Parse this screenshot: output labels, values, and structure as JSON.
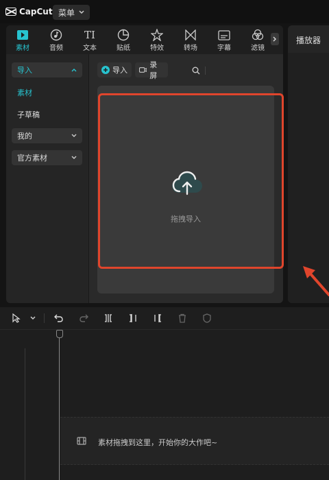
{
  "app": {
    "logo_text": "CapCut",
    "menu_label": "菜单"
  },
  "toolbar": {
    "tools": [
      {
        "label": "素材",
        "icon": "media-icon",
        "active": true
      },
      {
        "label": "音频",
        "icon": "audio-icon"
      },
      {
        "label": "文本",
        "icon": "text-icon",
        "glyph": "TI"
      },
      {
        "label": "贴纸",
        "icon": "sticker-icon"
      },
      {
        "label": "特效",
        "icon": "effects-icon"
      },
      {
        "label": "转场",
        "icon": "transition-icon"
      },
      {
        "label": "字幕",
        "icon": "captions-icon"
      },
      {
        "label": "滤镜",
        "icon": "filter-icon"
      }
    ]
  },
  "sidebar": {
    "import_label": "导入",
    "material_label": "素材",
    "subdraft_label": "子草稿",
    "mine_label": "我的",
    "official_label": "官方素材"
  },
  "content": {
    "import_btn": "导入",
    "record_btn": "录屏",
    "drop_label": "拖拽导入"
  },
  "player": {
    "title": "播放器"
  },
  "timeline": {
    "hint": "素材拖拽到这里，开始你的大作吧~"
  },
  "colors": {
    "accent": "#27c3cf",
    "highlight": "#e0452c",
    "arrow": "#e0452c"
  }
}
